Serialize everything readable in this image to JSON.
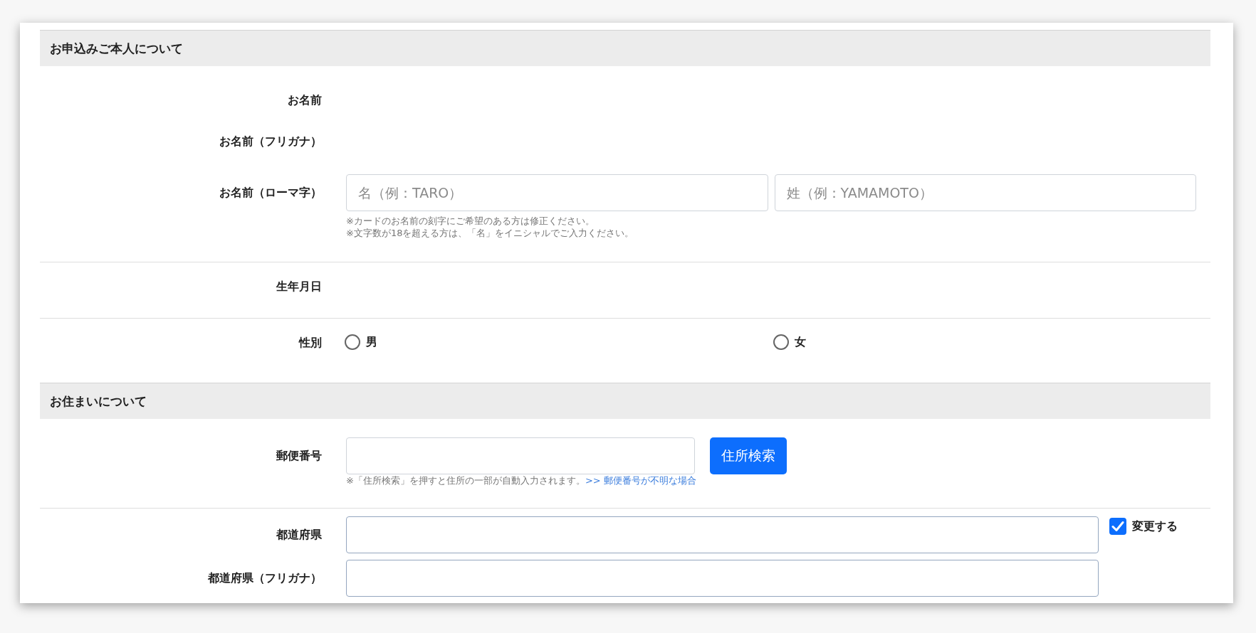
{
  "sections": [
    {
      "title": "お申込みご本人について",
      "groups": [
        [
          {
            "kind": "label",
            "label": "お名前"
          },
          {
            "kind": "label",
            "label": "お名前（フリガナ）"
          },
          {
            "kind": "name",
            "label": "お名前（ローマ字）",
            "inputs": [
              {
                "placeholder": "名（例：TARO）"
              },
              {
                "placeholder": "姓（例：YAMAMOTO）"
              }
            ],
            "notes": [
              "※カードのお名前の刻字にご希望のある方は修正ください。",
              "※文字数が18を超える方は、「名」をイニシャルでご入力ください。"
            ]
          }
        ],
        [
          {
            "kind": "label",
            "label": "生年月日"
          }
        ],
        [
          {
            "kind": "radio",
            "label": "性別",
            "options": [
              {
                "label": "男",
                "selected": false
              },
              {
                "label": "女",
                "selected": false
              }
            ]
          }
        ]
      ]
    },
    {
      "title": "お住まいについて",
      "groups": [
        [
          {
            "kind": "zip",
            "label": "郵便番号",
            "button": "住所検索",
            "note": "※「住所検索」を押すと住所の一部が自動入力されます。",
            "link": ">> 郵便番号が不明な場合"
          }
        ],
        [
          {
            "kind": "text",
            "label": "都道府県",
            "checkbox": {
              "label": "変更する",
              "checked": true
            }
          },
          {
            "kind": "text",
            "label": "都道府県（フリガナ）"
          }
        ]
      ]
    }
  ]
}
